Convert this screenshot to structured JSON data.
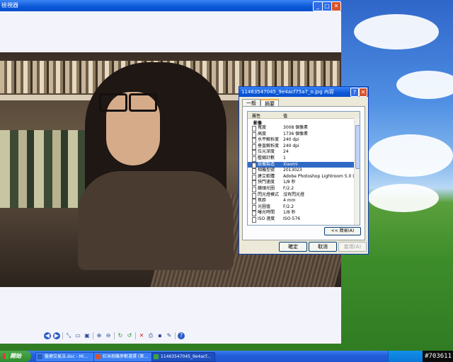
{
  "viewer": {
    "title": "檢視器"
  },
  "dialog": {
    "title": "11463547045_9e4acf75a7_o.jpg 內容",
    "help_glyph": "?",
    "close_glyph": "✕",
    "tabs": [
      "一般",
      "摘要"
    ],
    "list_headers": {
      "property": "屬性",
      "value": "值"
    },
    "section_label": "影像",
    "rows": [
      {
        "name": "寬度",
        "value": "3008 個像素"
      },
      {
        "name": "高度",
        "value": "1736 個像素"
      },
      {
        "name": "水平解析度",
        "value": "240 dpi"
      },
      {
        "name": "垂直解析度",
        "value": "240 dpi"
      },
      {
        "name": "位元深度",
        "value": "24"
      },
      {
        "name": "壓縮計數",
        "value": "1"
      },
      {
        "name": "設備製造",
        "value": "Xiaomi",
        "selected": true
      },
      {
        "name": "相機型號",
        "value": "2013023"
      },
      {
        "name": "建立軟體",
        "value": "Adobe Photoshop Lightroom 5.0 (Windo..."
      },
      {
        "name": "快門速度",
        "value": "1/8 秒"
      },
      {
        "name": "鏡頭光圈",
        "value": "F/2.2"
      },
      {
        "name": "閃光燈模式",
        "value": "沒有閃光燈"
      },
      {
        "name": "焦距",
        "value": "4 mm"
      },
      {
        "name": "光圈值",
        "value": "F/2.2"
      },
      {
        "name": "曝光時間",
        "value": "1/8 秒"
      },
      {
        "name": "ISO 速度",
        "value": "ISO-576"
      }
    ],
    "advanced_button": "<< 簡易(A)",
    "ok_button": "確定",
    "cancel_button": "取消",
    "apply_button": "套用(A)"
  },
  "taskbar": {
    "start_label": "開始",
    "tasks": [
      {
        "label": "醫療交易法.doc - Mi...",
        "icon_color": "#2b5fbf"
      },
      {
        "label": "紅米相機參數選擇 (第...",
        "icon_color": "#d9522a"
      },
      {
        "label": "11463547045_9e4acf...",
        "icon_color": "#3da43d"
      }
    ],
    "watermark": "#703611"
  },
  "colors": {
    "title_bar": "#0a58d8",
    "selection": "#316ac5",
    "dialog_face": "#ece9d8"
  },
  "icons": {
    "viewer_toolbar": [
      "previous-icon",
      "next-icon",
      "best-fit-icon",
      "actual-size-icon",
      "slideshow-icon",
      "zoom-in-icon",
      "zoom-out-icon",
      "rotate-clockwise-icon",
      "rotate-counterclockwise-icon",
      "delete-icon",
      "print-icon",
      "save-icon",
      "edit-icon",
      "help-icon"
    ]
  }
}
